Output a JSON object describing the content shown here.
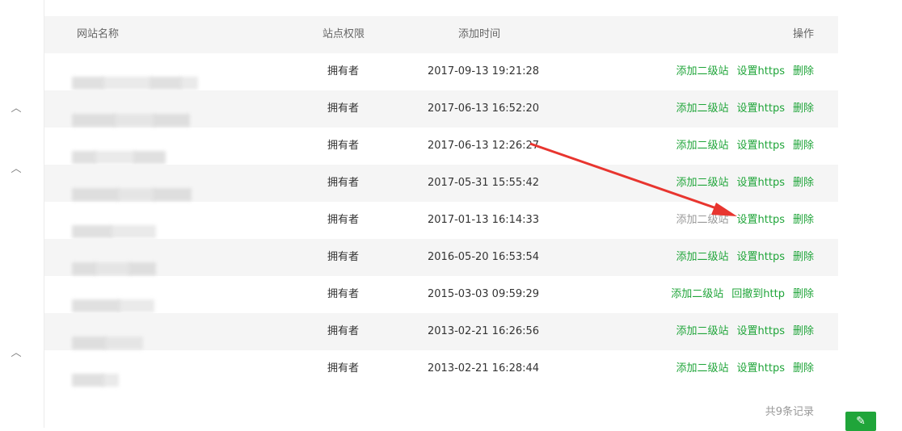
{
  "table": {
    "headers": {
      "name": "网站名称",
      "role": "站点权限",
      "time": "添加时间",
      "ops": "操作"
    },
    "rows": [
      {
        "role": "拥有者",
        "time": "2017-09-13 19:21:28",
        "ops": [
          "添加二级站",
          "设置https",
          "删除"
        ]
      },
      {
        "role": "拥有者",
        "time": "2017-06-13 16:52:20",
        "ops": [
          "添加二级站",
          "设置https",
          "删除"
        ]
      },
      {
        "role": "拥有者",
        "time": "2017-06-13 12:26:27",
        "ops": [
          "添加二级站",
          "设置https",
          "删除"
        ]
      },
      {
        "role": "拥有者",
        "time": "2017-05-31 15:55:42",
        "ops": [
          "添加二级站",
          "设置https",
          "删除"
        ]
      },
      {
        "role": "拥有者",
        "time": "2017-01-13 16:14:33",
        "ops": [
          "添加二级站",
          "设置https",
          "删除"
        ]
      },
      {
        "role": "拥有者",
        "time": "2016-05-20 16:53:54",
        "ops": [
          "添加二级站",
          "设置https",
          "删除"
        ]
      },
      {
        "role": "拥有者",
        "time": "2015-03-03 09:59:29",
        "ops": [
          "添加二级站",
          "回撤到http",
          "删除"
        ]
      },
      {
        "role": "拥有者",
        "time": "2013-02-21 16:26:56",
        "ops": [
          "添加二级站",
          "设置https",
          "删除"
        ]
      },
      {
        "role": "拥有者",
        "time": "2013-02-21 16:28:44",
        "ops": [
          "添加二级站",
          "设置https",
          "删除"
        ]
      }
    ]
  },
  "footer": {
    "record_count": "共9条记录"
  },
  "colors": {
    "accent": "#20a53a",
    "muted_link": "#999999",
    "arrow": "#e8352f"
  },
  "icons": {
    "collapse": "chevron-up-icon",
    "edit": "edit-icon"
  }
}
